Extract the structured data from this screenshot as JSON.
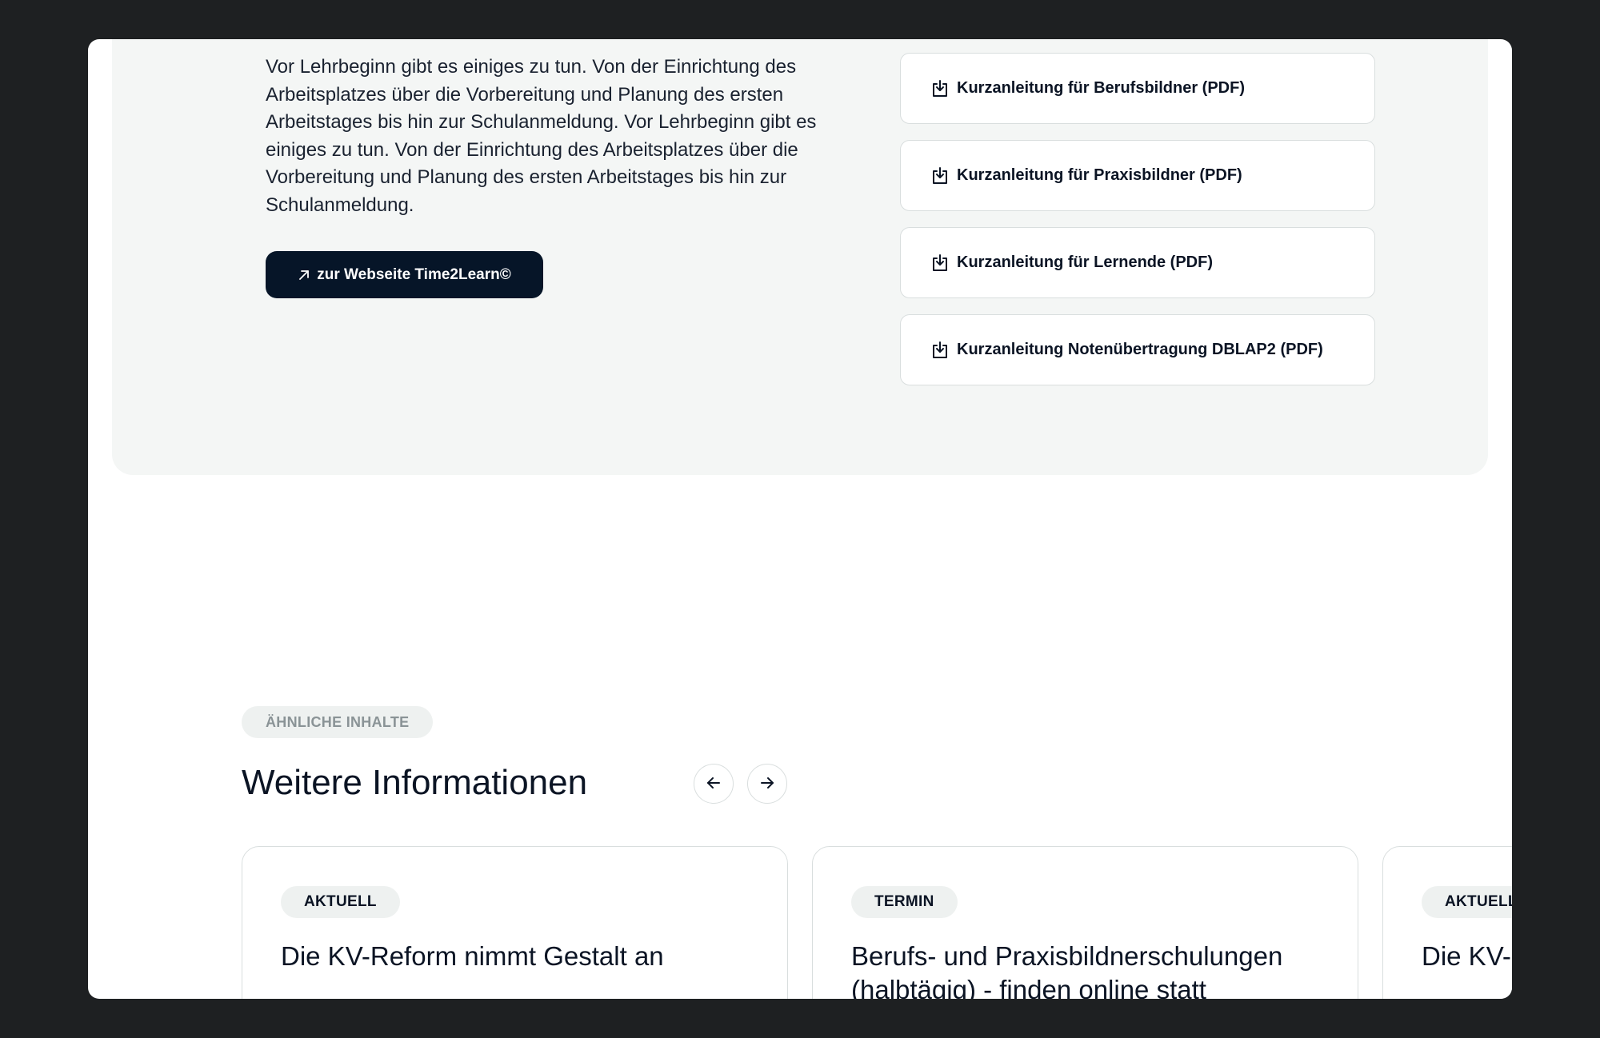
{
  "top_panel": {
    "intro_text": "Vor Lehrbeginn gibt es einiges zu tun. Von der Einrichtung des Arbeitsplatzes über die Vorbereitung und Planung des ersten Arbeitstages bis hin zur Schulanmeldung.  Vor Lehrbeginn gibt es einiges zu tun. Von der Einrichtung des Arbeitsplatzes über die Vorbereitung und Planung des ersten Arbeitstages bis hin zur Schulanmeldung.",
    "cta_label": "zur Webseite Time2Learn©",
    "cta_icon": "arrow-up-right-icon",
    "downloads": [
      {
        "label": "Kurzanleitung für Berufsbildner (PDF)",
        "icon": "download-icon"
      },
      {
        "label": "Kurzanleitung für Praxisbildner (PDF)",
        "icon": "download-icon"
      },
      {
        "label": "Kurzanleitung für Lernende (PDF)",
        "icon": "download-icon"
      },
      {
        "label": "Kurzanleitung Notenübertragung DBLAP2 (PDF)",
        "icon": "download-icon"
      }
    ]
  },
  "related": {
    "badge": "ÄHNLICHE INHALTE",
    "title": "Weitere Informationen",
    "prev_icon": "arrow-left-icon",
    "next_icon": "arrow-right-icon",
    "cards": [
      {
        "tag": "AKTUELL",
        "title": "Die KV-Reform nimmt Gestalt an"
      },
      {
        "tag": "TERMIN",
        "title": "Berufs- und Praxisbildnerschulungen (halbtägig) - finden online statt"
      },
      {
        "tag": "AKTUELL",
        "title": "Die KV-Reform nimmt Gestalt an"
      }
    ]
  },
  "colors": {
    "page_background": "#1e2022",
    "panel_background": "#f4f6f5",
    "primary_button": "#061528",
    "tag_background": "#eef1f0",
    "border": "#d9dede",
    "text": "#0b1424",
    "muted_text": "#8a9396"
  }
}
